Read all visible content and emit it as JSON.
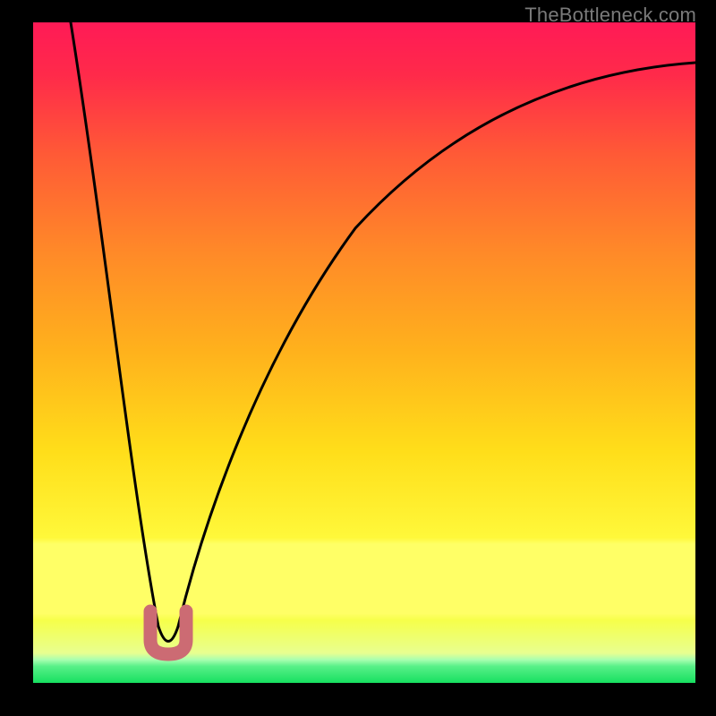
{
  "watermark": "TheBottleneck.com",
  "colors": {
    "top": "#ff1a56",
    "mid": "#ffde1a",
    "band": "#ffff66",
    "bottom": "#17e060",
    "curve": "#000000",
    "marker": "#cc6b73",
    "frame": "#000000"
  },
  "chart_data": {
    "type": "line",
    "title": "",
    "xlabel": "",
    "ylabel": "",
    "xlim": [
      0,
      100
    ],
    "ylim": [
      0,
      100
    ],
    "series": [
      {
        "name": "bottleneck-curve",
        "x": [
          5.7,
          8,
          10,
          12,
          14,
          16,
          18,
          19,
          20.4,
          22,
          24,
          28,
          35,
          45,
          55,
          65,
          75,
          85,
          95,
          100
        ],
        "y": [
          100,
          85,
          70,
          55,
          42,
          30,
          18,
          10,
          4.5,
          10,
          22,
          38,
          55,
          70,
          80,
          86,
          90,
          92.5,
          93.6,
          94
        ]
      }
    ],
    "annotations": [
      {
        "name": "optimal-region",
        "x_range": [
          17.7,
          23.1
        ],
        "y": 4.5
      }
    ],
    "background_bands": [
      {
        "name": "yellow-band",
        "y_range": [
          10.5,
          21
        ],
        "color": "#ffff66"
      },
      {
        "name": "green-band",
        "y_range": [
          0,
          4
        ],
        "color": "#17e060"
      }
    ]
  }
}
